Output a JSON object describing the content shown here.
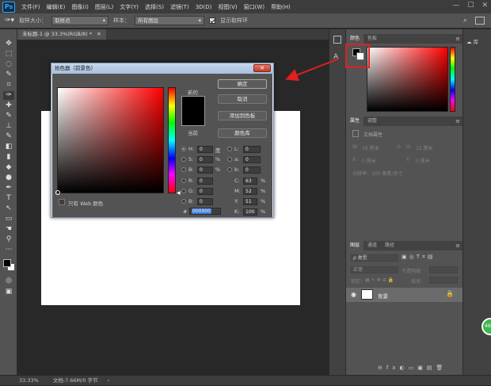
{
  "app": {
    "logo": "Ps"
  },
  "menubar": {
    "items": [
      "文件(F)",
      "编辑(E)",
      "图像(I)",
      "图层(L)",
      "文字(Y)",
      "选择(S)",
      "滤镜(T)",
      "3D(D)",
      "视图(V)",
      "窗口(W)",
      "帮助(H)"
    ],
    "win_controls": [
      "—",
      "☐",
      "✕"
    ]
  },
  "options_bar": {
    "sample_size_label": "取样大小：",
    "sample_size_value": "取样点",
    "sample_label": "样本：",
    "sample_value": "所有图层",
    "show_ring_label": "显示取样环",
    "show_ring_checked": true
  },
  "document": {
    "tab_title": "未标题-1 @ 33.3%(RGB/8) *",
    "canvas_color": "#ffffff"
  },
  "statusbar": {
    "zoom": "33.33%",
    "doc_info": "文档:7.66M/0 字节"
  },
  "toolbar": {
    "icons": [
      "move-icon",
      "marquee-icon",
      "lasso-icon",
      "quick-select-icon",
      "crop-icon",
      "eyedropper-icon",
      "healing-icon",
      "brush-icon",
      "stamp-icon",
      "history-brush-icon",
      "eraser-icon",
      "gradient-icon",
      "blur-icon",
      "dodge-icon",
      "pen-icon",
      "type-icon",
      "path-select-icon",
      "shape-icon",
      "hand-icon",
      "zoom-icon",
      "more-icon",
      "colors-icon",
      "quickmask-icon",
      "screenmode-icon"
    ],
    "glyphs": [
      "✥",
      "⬚",
      "◌",
      "✎",
      "⌗",
      "✑",
      "✚",
      "✎",
      "⊥",
      "✎",
      "◧",
      "▮",
      "💧",
      "●",
      "✒",
      "T",
      "↖",
      "▭",
      "✋",
      "🔍",
      "⋯",
      "■",
      "◎",
      "▣"
    ]
  },
  "color_panel": {
    "tabs": [
      "颜色",
      "色板"
    ],
    "active_tab": 0,
    "foreground": "#000000",
    "background": "#ffffff"
  },
  "properties_panel": {
    "tabs": [
      "属性",
      "调整"
    ],
    "active_tab": 0,
    "title": "文档属性",
    "width_label": "W:",
    "width_value": "16 厘米",
    "height_label": "H:",
    "height_value": "12 厘米",
    "x_label": "X:",
    "x_value": "0 厘米",
    "y_label": "Y:",
    "y_value": "0 厘米",
    "resolution": "分辨率：300 像素/英寸"
  },
  "layers_panel": {
    "tabs": [
      "图层",
      "通道",
      "路径"
    ],
    "active_tab": 0,
    "filter_label": "ρ 类型",
    "blend_mode": "正常",
    "opacity_label": "不透明度：",
    "lock_label": "锁定：",
    "fill_label": "填充：",
    "layers": [
      {
        "name": "背景",
        "visible": true,
        "locked": true
      }
    ]
  },
  "far_strip": {
    "label": "库"
  },
  "dialog": {
    "title": "拾色器（前景色）",
    "close_glyph": "✕",
    "new_label": "新的",
    "current_label": "当前",
    "web_colors_label": "只有 Web 颜色",
    "buttons": {
      "ok": "确定",
      "cancel": "取消",
      "add_swatch": "添加到色板",
      "libraries": "颜色库"
    },
    "hsb": [
      {
        "label": "H:",
        "value": "0",
        "unit": "度",
        "selected": true
      },
      {
        "label": "S:",
        "value": "0",
        "unit": "%",
        "selected": false
      },
      {
        "label": "B:",
        "value": "0",
        "unit": "%",
        "selected": false
      }
    ],
    "rgb": [
      {
        "label": "R:",
        "value": "0"
      },
      {
        "label": "G:",
        "value": "0"
      },
      {
        "label": "B:",
        "value": "0"
      }
    ],
    "lab": [
      {
        "label": "L:",
        "value": "0"
      },
      {
        "label": "a:",
        "value": "0"
      },
      {
        "label": "b:",
        "value": "0"
      }
    ],
    "cmyk": [
      {
        "label": "C:",
        "value": "63",
        "unit": "%"
      },
      {
        "label": "M:",
        "value": "52",
        "unit": "%"
      },
      {
        "label": "Y:",
        "value": "51",
        "unit": "%"
      },
      {
        "label": "K:",
        "value": "100",
        "unit": "%"
      }
    ],
    "hex_label": "#",
    "hex_value": "000000",
    "new_color": "#000000"
  },
  "float_button": {
    "label": "49"
  },
  "highlight_color": "#e02020"
}
